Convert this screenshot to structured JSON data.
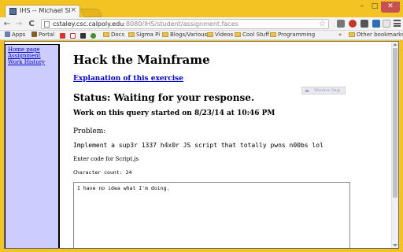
{
  "window": {
    "tab_title": "IHS -- Michael Slevin",
    "tab_close": "×",
    "controls": {
      "minimize": "–",
      "maximize": "□",
      "close": "✕"
    }
  },
  "toolbar": {
    "back": "←",
    "forward": "→",
    "reload": "C",
    "url_host": "cstaley.csc.calpoly.edu",
    "url_path": ":8080/IHS/student/assignment.faces",
    "star": "☆"
  },
  "bookmarks": {
    "items": [
      "Apps",
      "Portal",
      "Docs",
      "Sigma Pi",
      "Blogs/Various",
      "Videos",
      "Cool Stuff",
      "Programming"
    ],
    "overflow": "»",
    "other": "Other bookmarks"
  },
  "sidebar": {
    "links": [
      "Home page",
      "Assignment",
      "Work History"
    ]
  },
  "main": {
    "title": "Hack the Mainframe",
    "explanation_link": "Explanation of this exercise",
    "status": "Status: Waiting for your response.",
    "started": "Work on this query started on 8/23/14 at 10:46 PM",
    "problem_label": "Problem:",
    "problem_text": "Implement a sup3r 1337 h4x0r JS script that totally pwns n00bs lol",
    "code_prompt": "Enter code for Script.js",
    "char_count": "Character count: 24",
    "answer_value": "I have no idea what I'm doing."
  },
  "overlay": {
    "ghost_label": "Window Snip"
  },
  "colors": {
    "chrome_accent": "#f3c323",
    "sidebar_bg": "#ccccff",
    "link": "#0000cc"
  }
}
